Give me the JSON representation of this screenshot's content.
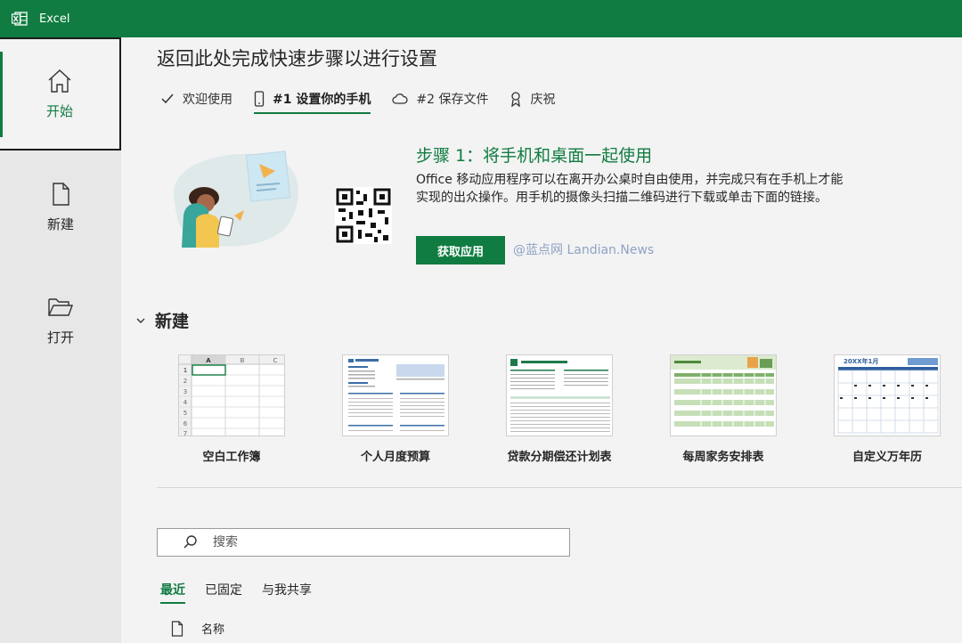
{
  "titlebar": {
    "app_name": "Excel"
  },
  "sidebar": {
    "items": [
      {
        "label": "开始",
        "icon": "home-icon",
        "active": true
      },
      {
        "label": "新建",
        "icon": "new-document-icon"
      },
      {
        "label": "打开",
        "icon": "open-folder-icon"
      }
    ]
  },
  "main": {
    "title": "返回此处完成快速步骤以进行设置",
    "steps": [
      {
        "label": "欢迎使用",
        "icon": "check-icon"
      },
      {
        "label": "#1 设置你的手机",
        "icon": "phone-icon",
        "active": true
      },
      {
        "label": "#2 保存文件",
        "icon": "cloud-icon"
      },
      {
        "label": "庆祝",
        "icon": "celebrate-icon"
      }
    ],
    "step_heading": "步骤 1：将手机和桌面一起使用",
    "step_desc": "Office 移动应用程序可以在离开办公桌时自由使用，并完成只有在手机上才能实现的出众操作。用手机的摄像头扫描二维码进行下载或单击下面的链接。",
    "get_app_label": "获取应用",
    "watermark": "@蓝点网 Landian.News"
  },
  "new_section": {
    "label": "新建",
    "templates": [
      {
        "label": "空白工作簿"
      },
      {
        "label": "个人月度预算"
      },
      {
        "label": "贷款分期偿还计划表"
      },
      {
        "label": "每周家务安排表"
      },
      {
        "label": "自定义万年历"
      }
    ]
  },
  "blank_sheet": {
    "columns": [
      "A",
      "B",
      "C"
    ],
    "rows": [
      "1",
      "2",
      "3",
      "4",
      "5",
      "6",
      "7"
    ]
  },
  "calendar_thumb_title": "20XX年1月",
  "search": {
    "placeholder": "搜索"
  },
  "tabs": [
    {
      "label": "最近",
      "active": true
    },
    {
      "label": "已固定"
    },
    {
      "label": "与我共享"
    }
  ],
  "list": {
    "name_header": "名称"
  },
  "colors": {
    "accent": "#107c41",
    "titlebar": "#107c41"
  }
}
